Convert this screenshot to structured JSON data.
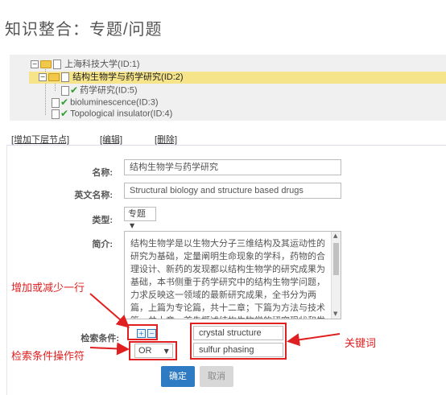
{
  "page_title": "知识整合：专题/问题",
  "tree": {
    "nodes": [
      {
        "label": "上海科技大学(ID:1)",
        "toggle": "−"
      },
      {
        "label": "结构生物学与药学研究(ID:2)",
        "toggle": "−"
      },
      {
        "label": "药学研究(ID:5)"
      },
      {
        "label": "bioluminescence(ID:3)"
      },
      {
        "label": "Topological insulator(ID:4)"
      }
    ]
  },
  "toolbar": {
    "add_child": "[增加下层节点]",
    "edit": "[编辑]",
    "delete": "[删除]"
  },
  "form": {
    "name_label": "名称:",
    "name_value": "结构生物学与药学研究",
    "en_name_label": "英文名称:",
    "en_name_value": "Structural biology and structure based drugs",
    "type_label": "类型:",
    "type_value": "专题",
    "summary_label": "简介:",
    "summary_value": "结构生物学是以生物大分子三维结构及其运动性的研究为基础，定量阐明生命现象的学科，药物的合理设计、新药的发现都以结构生物学的研究成果为基础，本书侧重于药学研究中的结构生物学问题，力求反映这一领域的最新研究成果，全书分为两篇，上篇为专论篇，共十二章；下篇为方法与技术篇，共十章，首先概述结构生物学的研究现状和发展",
    "criteria_label": "检索条件:",
    "operator_value": "OR",
    "keyword_1": "crystal structure",
    "keyword_2": "sulfur phasing",
    "add_row_symbol": "+",
    "remove_row_symbol": "−"
  },
  "buttons": {
    "ok": "确定",
    "cancel": "取消"
  },
  "annotations": {
    "add_remove": "增加或减少一行",
    "operator": "检索条件操作符",
    "keyword": "关键词"
  },
  "colors": {
    "accent": "#2e7ac3",
    "annotation_red": "#e02020",
    "selected_node": "#f5e48a"
  }
}
